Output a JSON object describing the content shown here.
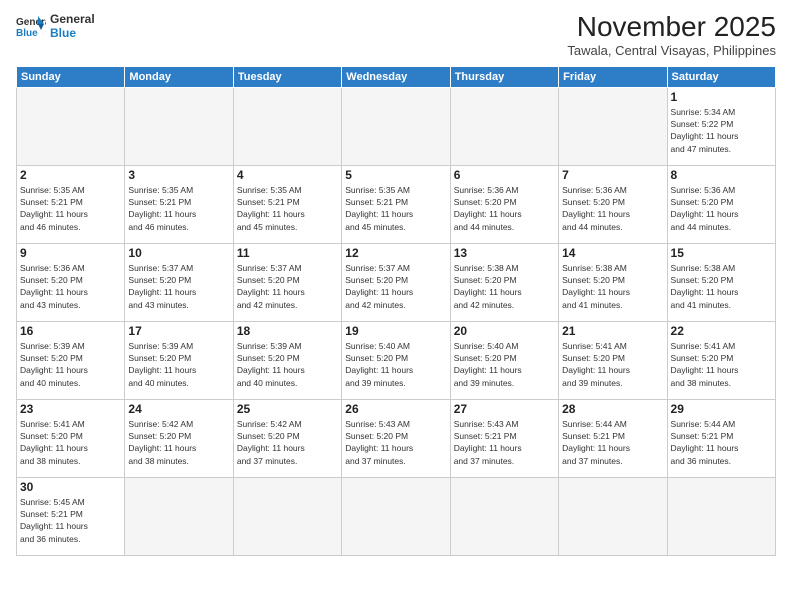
{
  "header": {
    "logo_line1": "General",
    "logo_line2": "Blue",
    "month_title": "November 2025",
    "location": "Tawala, Central Visayas, Philippines"
  },
  "weekdays": [
    "Sunday",
    "Monday",
    "Tuesday",
    "Wednesday",
    "Thursday",
    "Friday",
    "Saturday"
  ],
  "days": {
    "d1": {
      "n": "1",
      "rise": "5:34 AM",
      "set": "5:22 PM",
      "hours": "11 hours and 47 minutes."
    },
    "d2": {
      "n": "2",
      "rise": "5:35 AM",
      "set": "5:21 PM",
      "hours": "11 hours and 46 minutes."
    },
    "d3": {
      "n": "3",
      "rise": "5:35 AM",
      "set": "5:21 PM",
      "hours": "11 hours and 46 minutes."
    },
    "d4": {
      "n": "4",
      "rise": "5:35 AM",
      "set": "5:21 PM",
      "hours": "11 hours and 45 minutes."
    },
    "d5": {
      "n": "5",
      "rise": "5:35 AM",
      "set": "5:21 PM",
      "hours": "11 hours and 45 minutes."
    },
    "d6": {
      "n": "6",
      "rise": "5:36 AM",
      "set": "5:20 PM",
      "hours": "11 hours and 44 minutes."
    },
    "d7": {
      "n": "7",
      "rise": "5:36 AM",
      "set": "5:20 PM",
      "hours": "11 hours and 44 minutes."
    },
    "d8": {
      "n": "8",
      "rise": "5:36 AM",
      "set": "5:20 PM",
      "hours": "11 hours and 44 minutes."
    },
    "d9": {
      "n": "9",
      "rise": "5:36 AM",
      "set": "5:20 PM",
      "hours": "11 hours and 43 minutes."
    },
    "d10": {
      "n": "10",
      "rise": "5:37 AM",
      "set": "5:20 PM",
      "hours": "11 hours and 43 minutes."
    },
    "d11": {
      "n": "11",
      "rise": "5:37 AM",
      "set": "5:20 PM",
      "hours": "11 hours and 42 minutes."
    },
    "d12": {
      "n": "12",
      "rise": "5:37 AM",
      "set": "5:20 PM",
      "hours": "11 hours and 42 minutes."
    },
    "d13": {
      "n": "13",
      "rise": "5:38 AM",
      "set": "5:20 PM",
      "hours": "11 hours and 42 minutes."
    },
    "d14": {
      "n": "14",
      "rise": "5:38 AM",
      "set": "5:20 PM",
      "hours": "11 hours and 41 minutes."
    },
    "d15": {
      "n": "15",
      "rise": "5:38 AM",
      "set": "5:20 PM",
      "hours": "11 hours and 41 minutes."
    },
    "d16": {
      "n": "16",
      "rise": "5:39 AM",
      "set": "5:20 PM",
      "hours": "11 hours and 40 minutes."
    },
    "d17": {
      "n": "17",
      "rise": "5:39 AM",
      "set": "5:20 PM",
      "hours": "11 hours and 40 minutes."
    },
    "d18": {
      "n": "18",
      "rise": "5:39 AM",
      "set": "5:20 PM",
      "hours": "11 hours and 40 minutes."
    },
    "d19": {
      "n": "19",
      "rise": "5:40 AM",
      "set": "5:20 PM",
      "hours": "11 hours and 39 minutes."
    },
    "d20": {
      "n": "20",
      "rise": "5:40 AM",
      "set": "5:20 PM",
      "hours": "11 hours and 39 minutes."
    },
    "d21": {
      "n": "21",
      "rise": "5:41 AM",
      "set": "5:20 PM",
      "hours": "11 hours and 39 minutes."
    },
    "d22": {
      "n": "22",
      "rise": "5:41 AM",
      "set": "5:20 PM",
      "hours": "11 hours and 38 minutes."
    },
    "d23": {
      "n": "23",
      "rise": "5:41 AM",
      "set": "5:20 PM",
      "hours": "11 hours and 38 minutes."
    },
    "d24": {
      "n": "24",
      "rise": "5:42 AM",
      "set": "5:20 PM",
      "hours": "11 hours and 38 minutes."
    },
    "d25": {
      "n": "25",
      "rise": "5:42 AM",
      "set": "5:20 PM",
      "hours": "11 hours and 37 minutes."
    },
    "d26": {
      "n": "26",
      "rise": "5:43 AM",
      "set": "5:20 PM",
      "hours": "11 hours and 37 minutes."
    },
    "d27": {
      "n": "27",
      "rise": "5:43 AM",
      "set": "5:21 PM",
      "hours": "11 hours and 37 minutes."
    },
    "d28": {
      "n": "28",
      "rise": "5:44 AM",
      "set": "5:21 PM",
      "hours": "11 hours and 37 minutes."
    },
    "d29": {
      "n": "29",
      "rise": "5:44 AM",
      "set": "5:21 PM",
      "hours": "11 hours and 36 minutes."
    },
    "d30": {
      "n": "30",
      "rise": "5:45 AM",
      "set": "5:21 PM",
      "hours": "11 hours and 36 minutes."
    }
  }
}
